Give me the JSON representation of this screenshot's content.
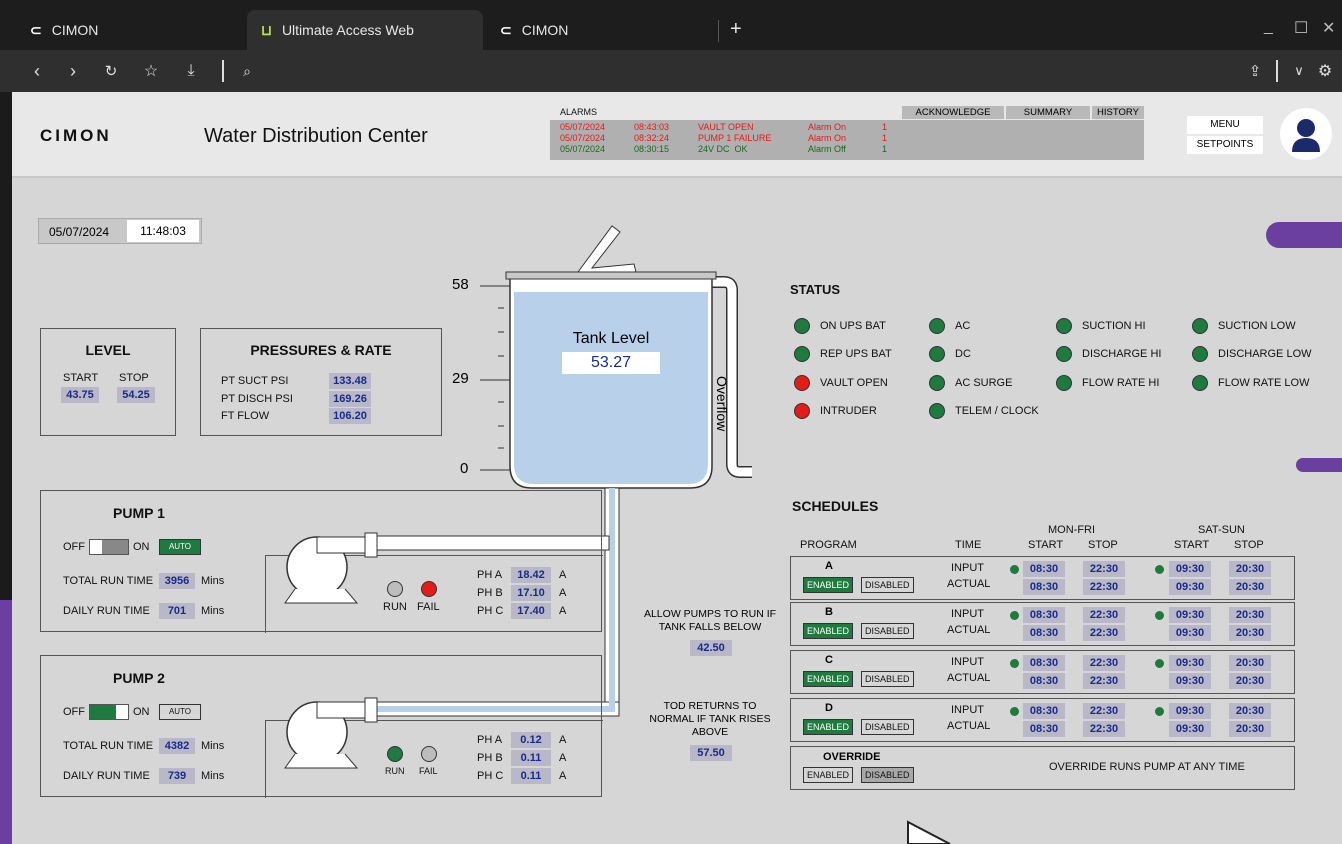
{
  "browser": {
    "tabs": [
      {
        "label": "CIMON"
      },
      {
        "label": "Ultimate Access Web"
      },
      {
        "label": "CIMON"
      }
    ],
    "new_tab": "+",
    "window": {
      "minimize": "_",
      "maximize": "☐",
      "close": "✕"
    }
  },
  "header": {
    "logo": "CIMON",
    "title": "Water Distribution Center",
    "alarms_label": "ALARMS",
    "alarm_buttons": [
      "ACKNOWLEDGE",
      "SUMMARY",
      "HISTORY"
    ],
    "alarms": [
      {
        "date": "05/07/2024",
        "time": "08:43:03",
        "msg": "VAULT OPEN",
        "state": "Alarm On",
        "count": "1"
      },
      {
        "date": "05/07/2024",
        "time": "08:32:24",
        "msg": "PUMP 1 FAILURE",
        "state": "Alarm On",
        "count": "1"
      },
      {
        "date": "05/07/2024",
        "time": "08:30:15",
        "msg": "24V DC  OK",
        "state": "Alarm Off",
        "count": "1"
      }
    ],
    "menu": "MENU",
    "setpoints": "SETPOINTS"
  },
  "datetime": {
    "date": "05/07/2024",
    "time": "11:48:03"
  },
  "level": {
    "title": "LEVEL",
    "start_label": "START",
    "stop_label": "STOP",
    "start": "43.75",
    "stop": "54.25"
  },
  "pressures": {
    "title": "PRESSURES & RATE",
    "rows": [
      {
        "label": "PT SUCT PSI",
        "value": "133.48"
      },
      {
        "label": "PT DISCH PSI",
        "value": "169.26"
      },
      {
        "label": "FT FLOW",
        "value": "106.20"
      }
    ]
  },
  "tank": {
    "label": "Tank Level",
    "value": "53.27",
    "scale": [
      "58",
      "29",
      "0"
    ],
    "overflow": "Overflow"
  },
  "status": {
    "title": "STATUS",
    "colors": {
      "green": "#1e7a3e",
      "red": "#e21b1b"
    },
    "items": [
      {
        "label": "ON UPS BAT",
        "state": "green"
      },
      {
        "label": "REP UPS BAT",
        "state": "green"
      },
      {
        "label": "VAULT OPEN",
        "state": "red"
      },
      {
        "label": "INTRUDER",
        "state": "red"
      },
      {
        "label": "AC",
        "state": "green"
      },
      {
        "label": "DC",
        "state": "green"
      },
      {
        "label": "AC SURGE",
        "state": "green"
      },
      {
        "label": "TELEM / CLOCK",
        "state": "green"
      },
      {
        "label": "SUCTION HI",
        "state": "green"
      },
      {
        "label": "DISCHARGE HI",
        "state": "green"
      },
      {
        "label": "FLOW RATE HI",
        "state": "green"
      },
      {
        "label": "SUCTION LOW",
        "state": "green"
      },
      {
        "label": "DISCHARGE LOW",
        "state": "green"
      },
      {
        "label": "FLOW RATE LOW",
        "state": "green"
      }
    ]
  },
  "pumps": [
    {
      "title": "PUMP 1",
      "off": "OFF",
      "on": "ON",
      "auto": "AUTO",
      "switch_on": false,
      "auto_active": true,
      "total_label": "TOTAL RUN TIME",
      "total": "3956",
      "daily_label": "DAILY RUN TIME",
      "daily": "701",
      "unit": "Mins",
      "run_label": "RUN",
      "fail_label": "FAIL",
      "run_state": "off",
      "fail_state": "on",
      "phases": [
        {
          "label": "PH A",
          "value": "18.42",
          "unit": "A"
        },
        {
          "label": "PH B",
          "value": "17.10",
          "unit": "A"
        },
        {
          "label": "PH C",
          "value": "17.40",
          "unit": "A"
        }
      ]
    },
    {
      "title": "PUMP 2",
      "off": "OFF",
      "on": "ON",
      "auto": "AUTO",
      "switch_on": true,
      "auto_active": false,
      "total_label": "TOTAL RUN TIME",
      "total": "4382",
      "daily_label": "DAILY RUN TIME",
      "daily": "739",
      "unit": "Mins",
      "run_label": "RUN",
      "fail_label": "FAIL",
      "run_state": "on",
      "fail_state": "off",
      "phases": [
        {
          "label": "PH A",
          "value": "0.12",
          "unit": "A"
        },
        {
          "label": "PH B",
          "value": "0.11",
          "unit": "A"
        },
        {
          "label": "PH C",
          "value": "0.11",
          "unit": "A"
        }
      ]
    }
  ],
  "allow_pumps": {
    "text": "ALLOW PUMPS TO RUN IF TANK FALLS BELOW",
    "value": "42.50"
  },
  "tod_returns": {
    "text": "TOD RETURNS TO NORMAL IF TANK RISES ABOVE",
    "value": "57.50"
  },
  "schedules": {
    "title": "SCHEDULES",
    "monfri": "MON-FRI",
    "satsun": "SAT-SUN",
    "col_program": "PROGRAM",
    "col_time": "TIME",
    "col_start": "START",
    "col_stop": "STOP",
    "input_label": "INPUT",
    "actual_label": "ACTUAL",
    "enabled": "ENABLED",
    "disabled": "DISABLED",
    "programs": [
      {
        "name": "A",
        "mf_in_start": "08:30",
        "mf_in_stop": "22:30",
        "mf_act_start": "08:30",
        "mf_act_stop": "22:30",
        "ss_in_start": "09:30",
        "ss_in_stop": "20:30",
        "ss_act_start": "09:30",
        "ss_act_stop": "20:30"
      },
      {
        "name": "B",
        "mf_in_start": "08:30",
        "mf_in_stop": "22:30",
        "mf_act_start": "08:30",
        "mf_act_stop": "22:30",
        "ss_in_start": "09:30",
        "ss_in_stop": "20:30",
        "ss_act_start": "09:30",
        "ss_act_stop": "20:30"
      },
      {
        "name": "C",
        "mf_in_start": "08:30",
        "mf_in_stop": "22:30",
        "mf_act_start": "08:30",
        "mf_act_stop": "22:30",
        "ss_in_start": "09:30",
        "ss_in_stop": "20:30",
        "ss_act_start": "09:30",
        "ss_act_stop": "20:30"
      },
      {
        "name": "D",
        "mf_in_start": "08:30",
        "mf_in_stop": "22:30",
        "mf_act_start": "08:30",
        "mf_act_stop": "22:30",
        "ss_in_start": "09:30",
        "ss_in_stop": "20:30",
        "ss_act_start": "09:30",
        "ss_act_stop": "20:30"
      }
    ],
    "override_title": "OVERRIDE",
    "override_text": "OVERRIDE RUNS PUMP AT ANY TIME"
  }
}
